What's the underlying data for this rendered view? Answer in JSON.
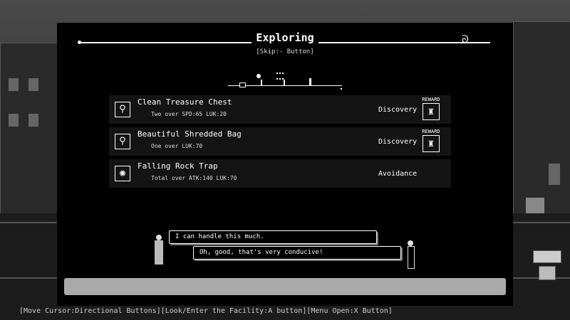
{
  "header": {
    "title": "Exploring",
    "skip_hint": "[Skip:- Button]"
  },
  "events": [
    {
      "name": "Clean Treasure Chest",
      "requirement": "Two over SPD:65 LUK:20",
      "type": "Discovery",
      "icon": "magnifier-icon",
      "reward": "REWARD"
    },
    {
      "name": "Beautiful Shredded Bag",
      "requirement": "One over LUK:70",
      "type": "Discovery",
      "icon": "magnifier-icon",
      "reward": "REWARD"
    },
    {
      "name": "Falling Rock Trap",
      "requirement": "Total over ATK:140 LUK:70",
      "type": "Avoidance",
      "icon": "eye-icon",
      "reward": ""
    }
  ],
  "dialogue": [
    {
      "text": "I can handle this much."
    },
    {
      "text": "Oh, good, that's very conducive!"
    }
  ],
  "controls_hint": "[Move Cursor:Directional Buttons][Look/Enter the Facility:A button][Menu Open:X Button]",
  "colors": {
    "panel": "#000000",
    "text": "#ffffff",
    "row": "#141414"
  }
}
